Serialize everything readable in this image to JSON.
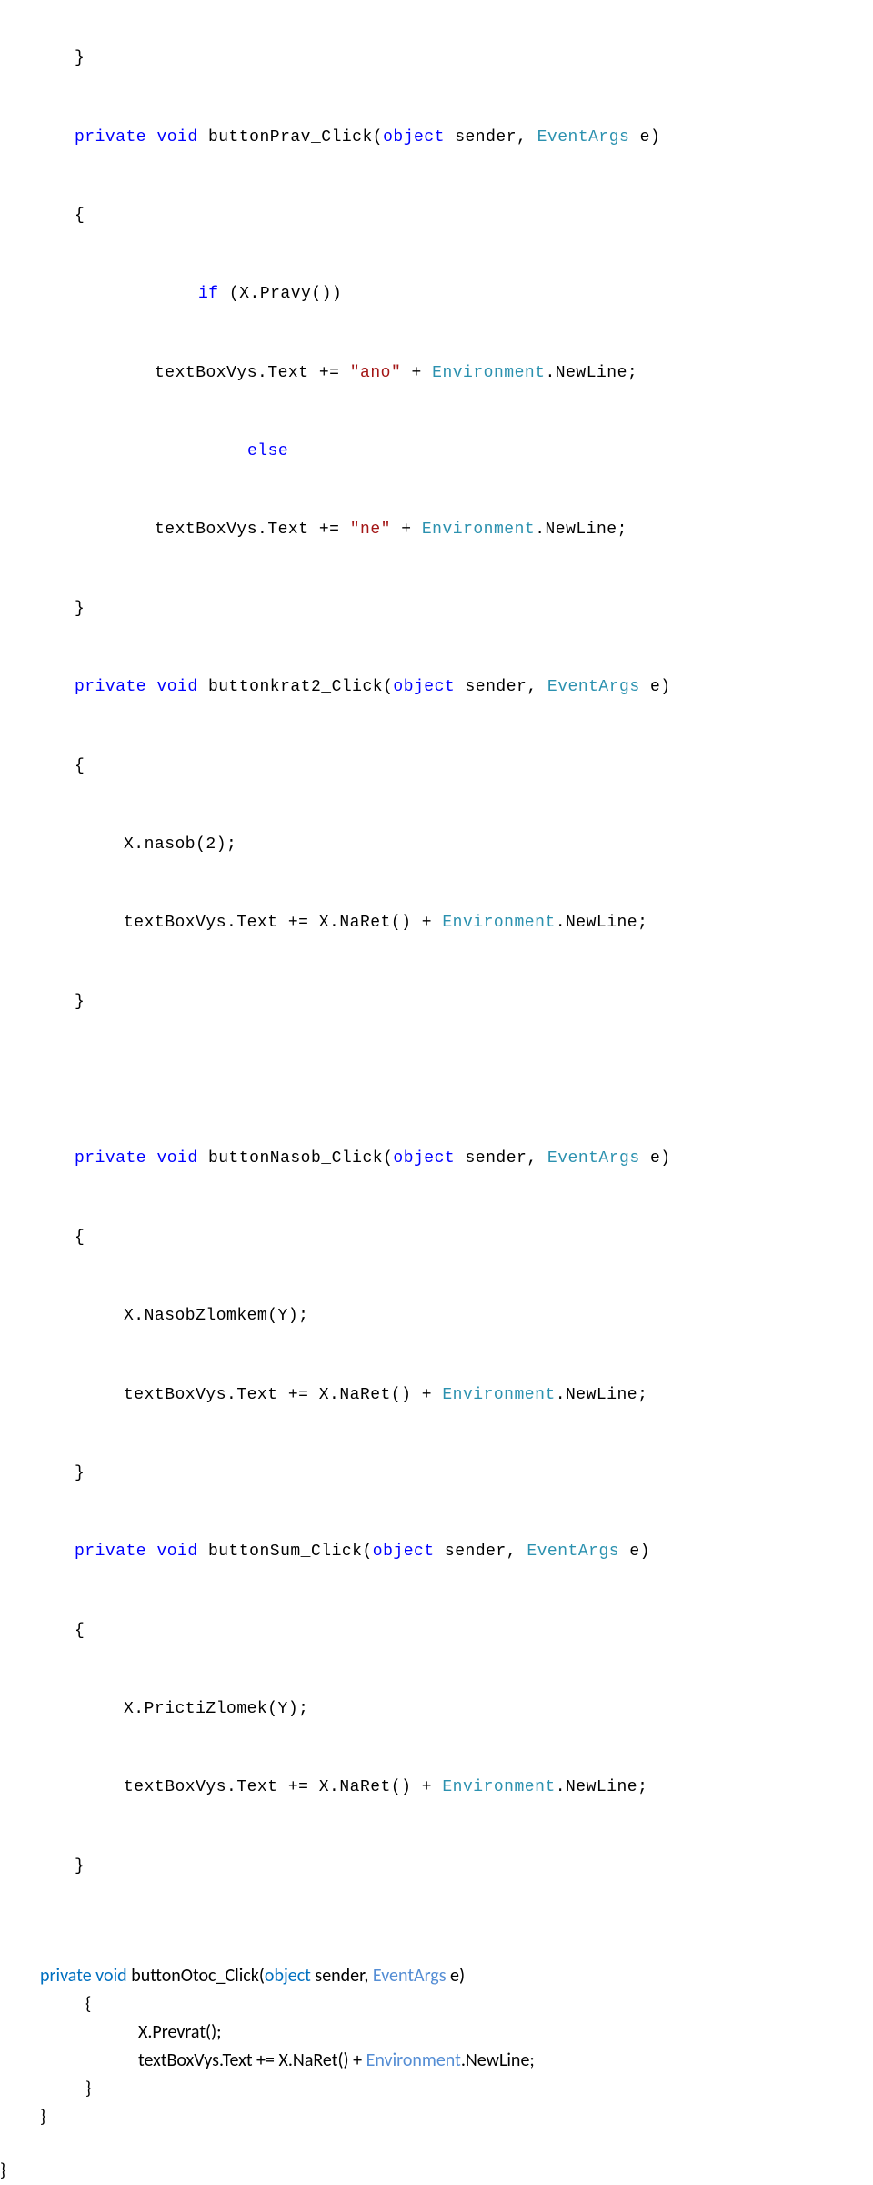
{
  "lines": {
    "l1": "}",
    "l2_kw1": "private",
    "l2_kw2": "void",
    "l2_t1": " buttonPrav_Click(",
    "l2_kw3": "object",
    "l2_t2": " sender, ",
    "l2_type": "EventArgs",
    "l2_t3": " e)",
    "l3": "{",
    "l4_kw": "if",
    "l4_t": " (X.Pravy())",
    "l5_t1": "textBoxVys.Text += ",
    "l5_str": "\"ano\"",
    "l5_t2": " + ",
    "l5_type": "Environment",
    "l5_t3": ".NewLine;",
    "l6_kw": "else",
    "l7_t1": "textBoxVys.Text += ",
    "l7_str": "\"ne\"",
    "l7_t2": " + ",
    "l7_type": "Environment",
    "l7_t3": ".NewLine;",
    "l8": "}",
    "l9_kw1": "private",
    "l9_kw2": "void",
    "l9_t1": " buttonkrat2_Click(",
    "l9_kw3": "object",
    "l9_t2": " sender, ",
    "l9_type": "EventArgs",
    "l9_t3": " e)",
    "l10": "{",
    "l11": "X.nasob(2);",
    "l12_t1": "textBoxVys.Text += X.NaRet() + ",
    "l12_type": "Environment",
    "l12_t2": ".NewLine;",
    "l13": "}",
    "l14_kw1": "private",
    "l14_kw2": "void",
    "l14_t1": " buttonNasob_Click(",
    "l14_kw3": "object",
    "l14_t2": " sender, ",
    "l14_type": "EventArgs",
    "l14_t3": " e)",
    "l15": "{",
    "l16": "X.NasobZlomkem(Y);",
    "l17_t1": "textBoxVys.Text += X.NaRet() + ",
    "l17_type": "Environment",
    "l17_t2": ".NewLine;",
    "l18": "}",
    "l19_kw1": "private",
    "l19_kw2": "void",
    "l19_t1": " buttonSum_Click(",
    "l19_kw3": "object",
    "l19_t2": " sender, ",
    "l19_type": "EventArgs",
    "l19_t3": " e)",
    "l20": "{",
    "l21": "X.PrictiZlomek(Y);",
    "l22_t1": "textBoxVys.Text += X.NaRet() + ",
    "l22_type": "Environment",
    "l22_t2": ".NewLine;",
    "l23": "}"
  },
  "alt": {
    "a1_kw1": "private",
    "a1_kw2": "void",
    "a1_t1": " buttonOtoc_Click(",
    "a1_kw3": "object",
    "a1_t2": " sender, ",
    "a1_type": "EventArgs",
    "a1_t3": " e)",
    "a2": "{",
    "a3": "X.Prevrat();",
    "a4_t1": "textBoxVys.Text += X.NaRet() + ",
    "a4_type": "Environment",
    "a4_t2": ".NewLine;",
    "a5": "}",
    "a6": "}",
    "a7": "}"
  }
}
